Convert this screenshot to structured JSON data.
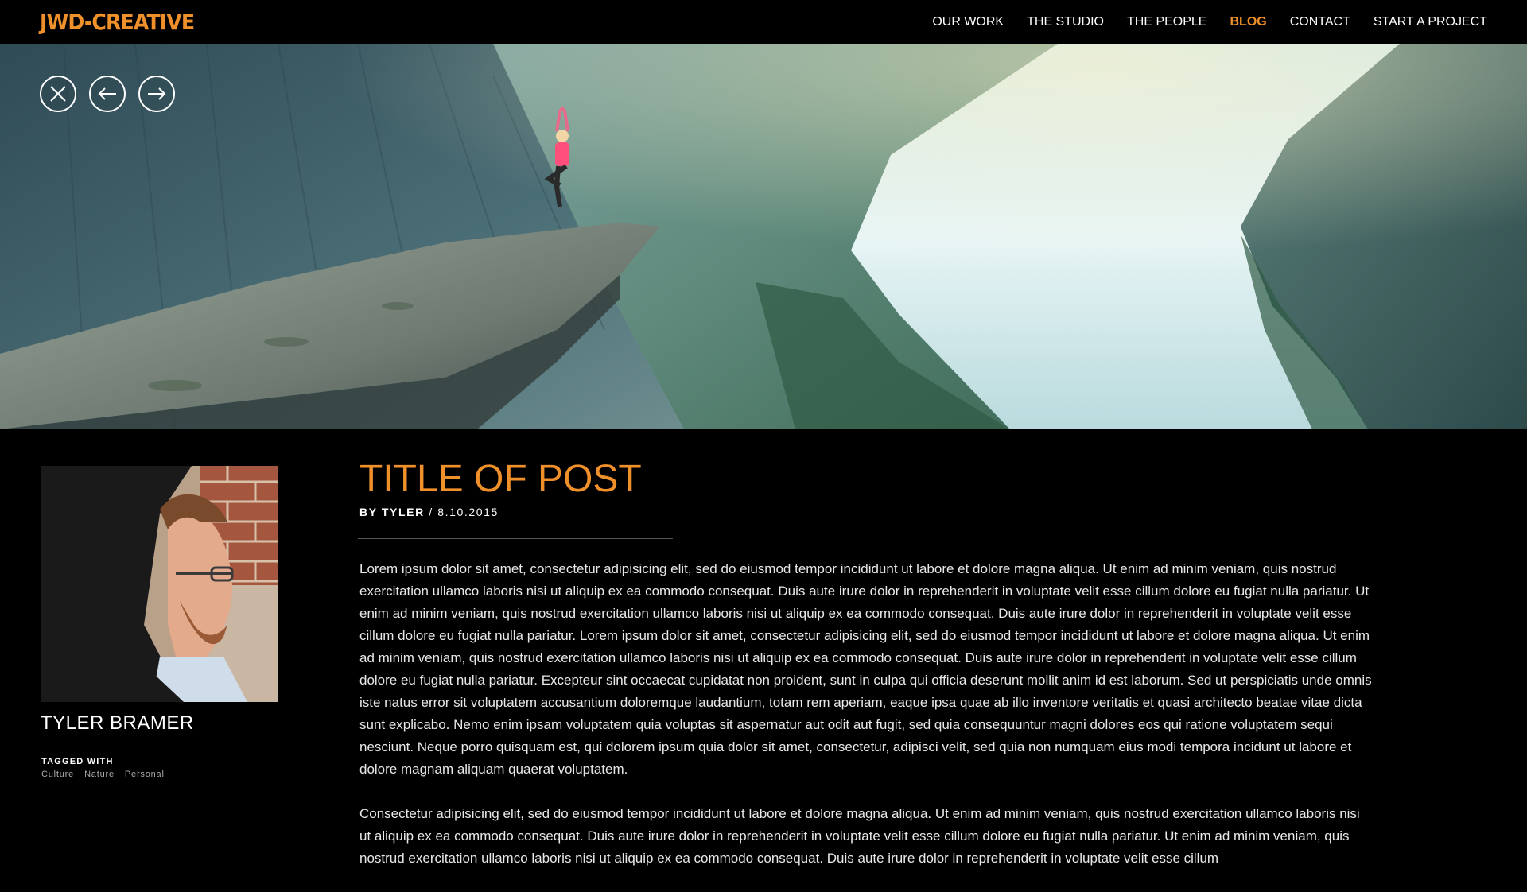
{
  "brand": {
    "logo_text": "JWD-CREATIVE",
    "accent_color": "#f0902a"
  },
  "nav": {
    "items": [
      {
        "label": "OUR WORK"
      },
      {
        "label": "THE STUDIO"
      },
      {
        "label": "THE PEOPLE"
      },
      {
        "label": "BLOG"
      },
      {
        "label": "CONTACT"
      },
      {
        "label": "START A PROJECT"
      }
    ],
    "active_label": "BLOG"
  },
  "hero": {
    "controls": [
      {
        "icon": "close-icon"
      },
      {
        "icon": "arrow-left-icon"
      },
      {
        "icon": "arrow-right-icon"
      }
    ]
  },
  "author": {
    "name": "TYLER BRAMER"
  },
  "tags": {
    "label": "TAGGED WITH",
    "items": [
      "Culture",
      "Nature",
      "Personal"
    ]
  },
  "post": {
    "title": "TITLE OF POST",
    "byline_prefix": "BY TYLER",
    "byline_sep": " / ",
    "date": "8.10.2015",
    "paragraphs": [
      "Lorem ipsum dolor sit amet, consectetur adipisicing elit, sed do eiusmod tempor incididunt ut labore et dolore magna aliqua. Ut enim ad minim veniam, quis nostrud exercitation ullamco laboris nisi ut aliquip ex ea commodo consequat. Duis aute irure dolor in reprehenderit in voluptate velit esse cillum dolore eu fugiat nulla pariatur. Ut enim ad minim veniam, quis nostrud exercitation ullamco laboris nisi ut aliquip ex ea commodo consequat. Duis aute irure dolor in reprehenderit in voluptate velit esse cillum dolore eu fugiat nulla pariatur. Lorem ipsum dolor sit amet, consectetur adipisicing elit, sed do eiusmod tempor incididunt ut labore et dolore magna aliqua. Ut enim ad minim veniam, quis nostrud exercitation ullamco laboris nisi ut aliquip ex ea commodo consequat. Duis aute irure dolor in reprehenderit in voluptate velit esse cillum dolore eu fugiat nulla pariatur. Excepteur sint occaecat cupidatat non proident, sunt in culpa qui officia deserunt mollit anim id est laborum. Sed ut perspiciatis unde omnis iste natus error sit voluptatem accusantium doloremque laudantium, totam rem aperiam, eaque ipsa quae ab illo inventore veritatis et quasi architecto beatae vitae dicta sunt explicabo. Nemo enim ipsam voluptatem quia voluptas sit aspernatur aut odit aut fugit, sed quia consequuntur magni dolores eos qui ratione voluptatem sequi nesciunt. Neque porro quisquam est, qui dolorem ipsum quia dolor sit amet, consectetur, adipisci velit, sed quia non numquam eius modi tempora incidunt ut labore et dolore magnam aliquam quaerat voluptatem.",
      "Consectetur adipisicing elit, sed do eiusmod tempor incididunt ut labore et dolore magna aliqua. Ut enim ad minim veniam, quis nostrud exercitation ullamco laboris nisi ut aliquip ex ea commodo consequat. Duis aute irure dolor in reprehenderit in voluptate velit esse cillum dolore eu fugiat nulla pariatur. Ut enim ad minim veniam, quis nostrud exercitation ullamco laboris nisi ut aliquip ex ea commodo consequat. Duis aute irure dolor in reprehenderit in voluptate velit esse cillum"
    ]
  }
}
